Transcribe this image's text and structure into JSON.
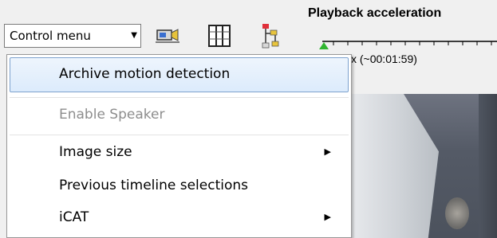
{
  "toolbar": {
    "control_menu_label": "Control menu",
    "control_menu_arrow": "▼",
    "buttons": [
      {
        "icon": "camera-export-icon"
      },
      {
        "icon": "film-frames-icon"
      },
      {
        "icon": "network-tree-icon"
      }
    ],
    "playback_title": "Playback acceleration"
  },
  "timeline": {
    "position_text": "x (~00:01:59)"
  },
  "context_menu": {
    "items": [
      {
        "label": "Archive motion detection",
        "state": "highlighted"
      },
      {
        "label": "Enable Speaker",
        "state": "disabled"
      },
      {
        "label": "Image size",
        "has_submenu": true
      },
      {
        "label": "Previous timeline selections"
      },
      {
        "label": "iCAT",
        "has_submenu": true
      }
    ],
    "submenu_arrow": "▶"
  },
  "colors": {
    "highlight_border": "#7da2ce",
    "highlight_fill": "#dcebfc",
    "disabled_text": "#8d8d8d",
    "slider_marker": "#2fb52f"
  }
}
